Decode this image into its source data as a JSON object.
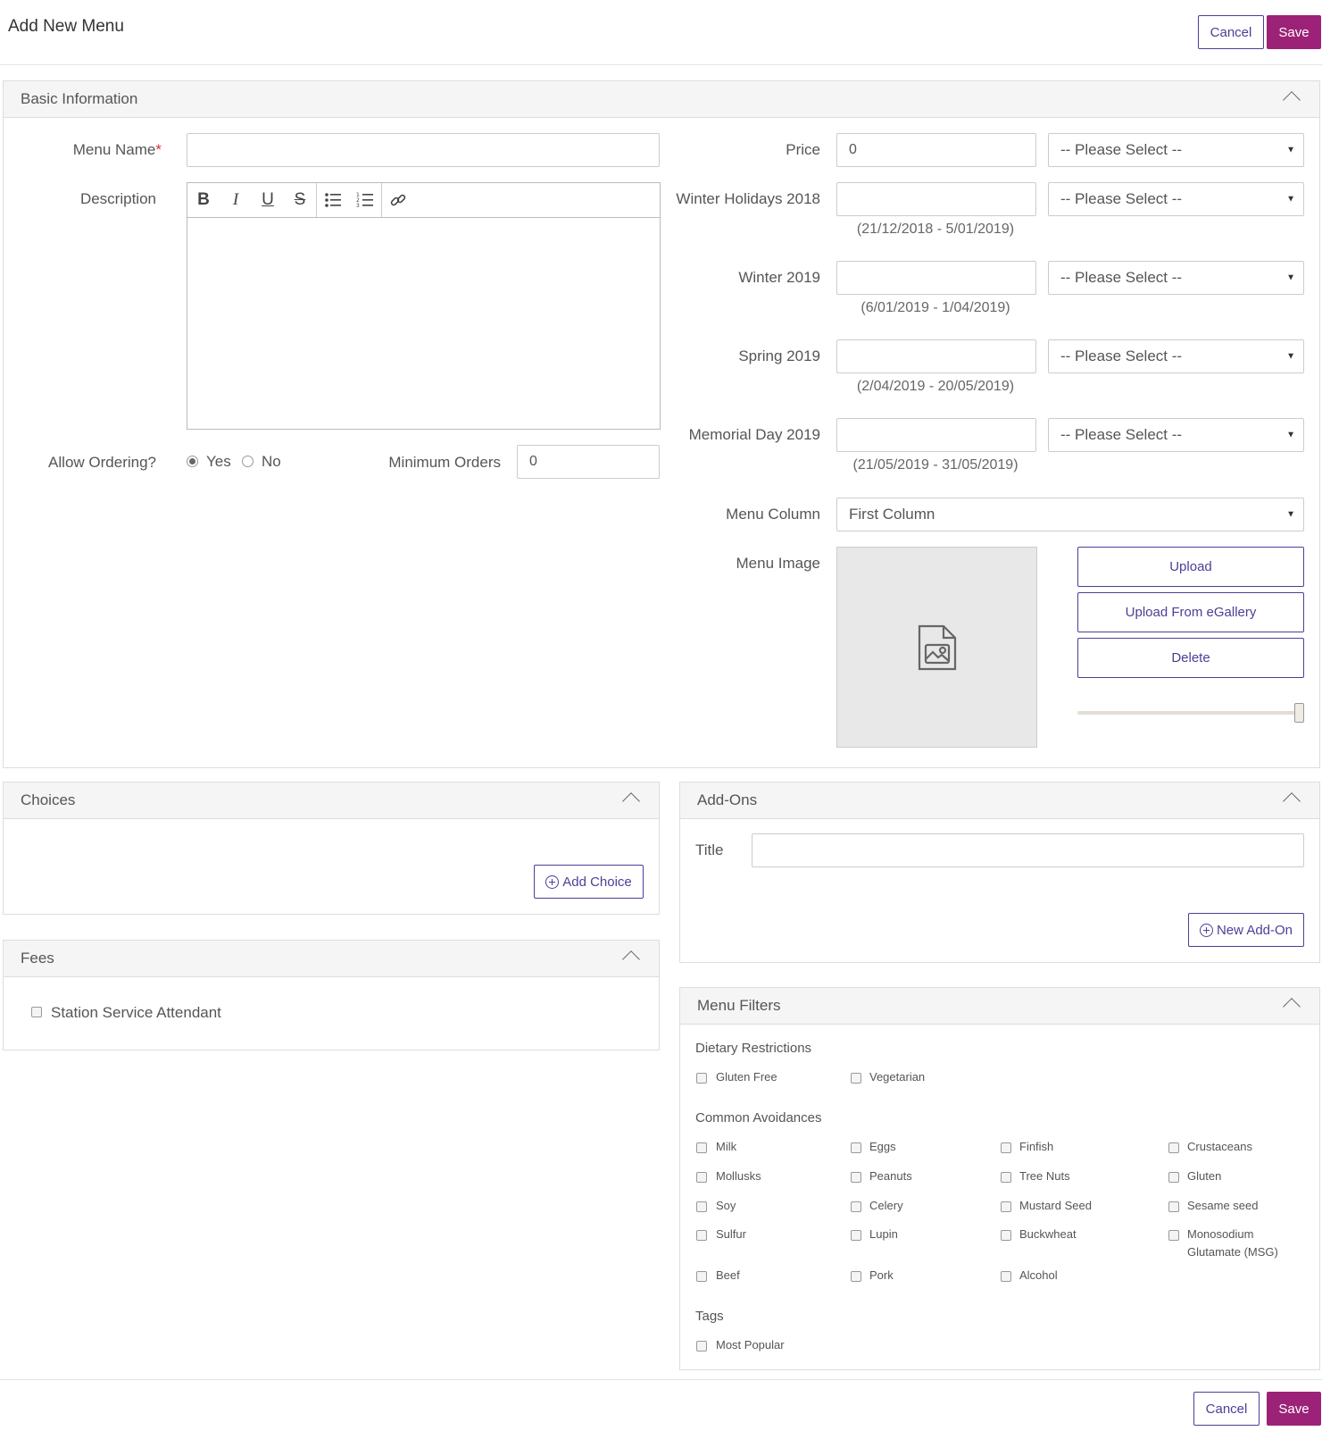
{
  "header": {
    "title": "Add New Menu",
    "cancel": "Cancel",
    "save": "Save"
  },
  "colors": {
    "accent": "#9c2277",
    "outline": "#4b3f96"
  },
  "basic": {
    "title": "Basic Information",
    "menu_name_label": "Menu Name",
    "required_mark": "*",
    "menu_name_value": "",
    "description_label": "Description",
    "toolbar": {
      "bold": "B",
      "italic": "I",
      "underline": "U",
      "strike": "S"
    },
    "allow_ordering_label": "Allow Ordering?",
    "yes": "Yes",
    "no": "No",
    "allow_ordering_selected": "Yes",
    "min_orders_label": "Minimum Orders",
    "min_orders_value": "0",
    "price_label": "Price",
    "price_value": "0",
    "please_select": "-- Please Select --",
    "periods": [
      {
        "label": "Winter Holidays 2018",
        "range": "(21/12/2018 - 5/01/2019)"
      },
      {
        "label": "Winter 2019",
        "range": "(6/01/2019 - 1/04/2019)"
      },
      {
        "label": "Spring 2019",
        "range": "(2/04/2019 - 20/05/2019)"
      },
      {
        "label": "Memorial Day 2019",
        "range": "(21/05/2019 - 31/05/2019)"
      }
    ],
    "menu_column_label": "Menu Column",
    "menu_column_value": "First Column",
    "menu_image_label": "Menu Image",
    "upload": "Upload",
    "upload_gallery": "Upload From eGallery",
    "delete": "Delete",
    "image_slider_value": 1.0
  },
  "choices": {
    "title": "Choices",
    "add": "Add Choice"
  },
  "fees": {
    "title": "Fees",
    "item": "Station Service Attendant"
  },
  "addons": {
    "title": "Add-Ons",
    "title_label": "Title",
    "title_value": "",
    "new": "New Add-On"
  },
  "filters": {
    "title": "Menu Filters",
    "dietary_title": "Dietary Restrictions",
    "dietary": [
      "Gluten Free",
      "Vegetarian"
    ],
    "avoid_title": "Common Avoidances",
    "avoid": [
      "Milk",
      "Eggs",
      "Finfish",
      "Crustaceans",
      "Mollusks",
      "Peanuts",
      "Tree Nuts",
      "Gluten",
      "Soy",
      "Celery",
      "Mustard Seed",
      "Sesame seed",
      "Sulfur",
      "Lupin",
      "Buckwheat",
      "Monosodium",
      "Glutamate (MSG)",
      "Beef",
      "Pork",
      "Alcohol"
    ],
    "tags_title": "Tags",
    "tags": [
      "Most Popular"
    ]
  },
  "footer": {
    "cancel": "Cancel",
    "save": "Save"
  }
}
